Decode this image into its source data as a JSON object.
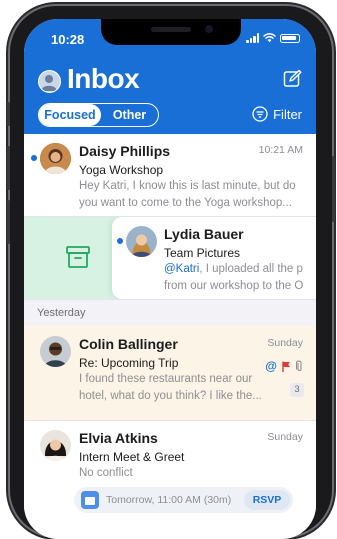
{
  "status": {
    "time": "10:28"
  },
  "header": {
    "title": "Inbox",
    "tabs": [
      {
        "label": "Focused"
      },
      {
        "label": "Other"
      }
    ],
    "filter_label": "Filter"
  },
  "messages": [
    {
      "sender": "Daisy Phillips",
      "subject": "Yoga Workshop",
      "preview": "Hey Katri, I know this is last minute, but do you want to come to the Yoga workshop...",
      "preview_lines": [
        "Hey Katri, I know this is last minute, but do",
        "you want to come to the Yoga workshop..."
      ],
      "time": "10:21 AM",
      "unread": true
    },
    {
      "sender": "Lydia Bauer",
      "subject": "Team Pictures",
      "mention": "@Katri",
      "preview_lines": [
        ", I uploaded all the p",
        "from our workshop to the O"
      ],
      "unread": true,
      "swipe_action": "archive"
    }
  ],
  "sections": [
    {
      "label": "Yesterday"
    }
  ],
  "yesterday": [
    {
      "sender": "Colin Ballinger",
      "subject": "Re: Upcoming Trip",
      "preview_lines": [
        "I found these restaurants near our",
        "hotel, what do you think? I like the..."
      ],
      "time": "Sunday",
      "thread_count": "3",
      "flags": [
        "mention-icon",
        "flag-icon",
        "attachment-icon"
      ]
    },
    {
      "sender": "Elvia Atkins",
      "subject": "Intern Meet & Greet",
      "preview": "No conflict",
      "time": "Sunday",
      "event": {
        "when": "Tomorrow, 11:00 AM (30m)",
        "rsvp_label": "RSVP"
      }
    }
  ],
  "colors": {
    "brand": "#1a6fd6",
    "archive_bg": "#d7f2e3",
    "highlight_bg": "#fcf4e6",
    "flag": "#e03b3b"
  }
}
